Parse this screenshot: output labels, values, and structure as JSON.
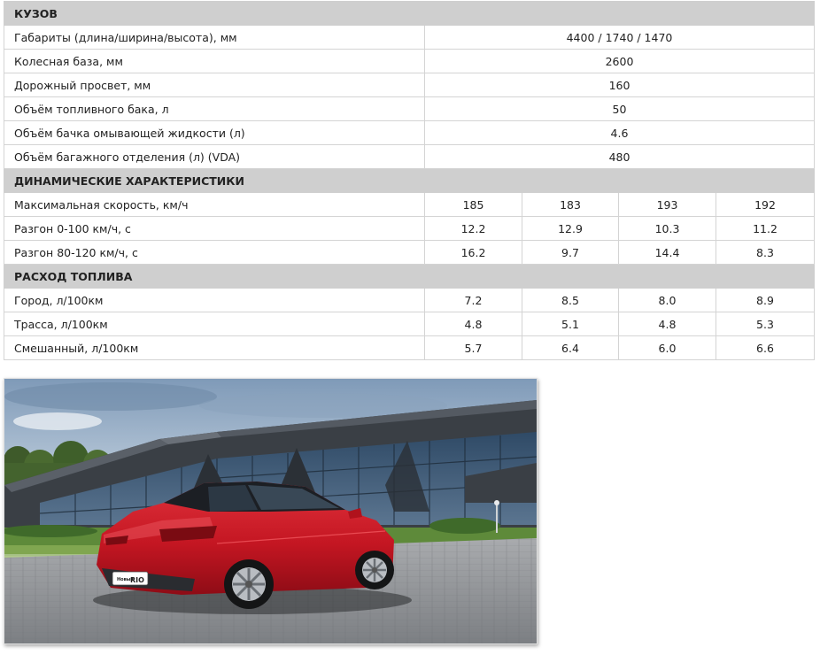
{
  "sections": [
    {
      "title": "КУЗОВ",
      "rows": [
        {
          "label": "Габариты (длина/ширина/высота), мм",
          "value": "4400 / 1740 / 1470",
          "highlighted": true
        },
        {
          "label": "Колесная база, мм",
          "value": "2600"
        },
        {
          "label": "Дорожный просвет, мм",
          "value": "160"
        },
        {
          "label": "Объём топливного бака, л",
          "value": "50"
        },
        {
          "label": "Объём бачка омывающей жидкости (л)",
          "value": "4.6"
        },
        {
          "label": "Объём багажного отделения (л) (VDA)",
          "value": "480"
        }
      ]
    },
    {
      "title": "ДИНАМИЧЕСКИЕ ХАРАКТЕРИСТИКИ",
      "rows": [
        {
          "label": "Максимальная скорость, км/ч",
          "values": [
            "185",
            "183",
            "193",
            "192"
          ]
        },
        {
          "label": "Разгон 0-100 км/ч, с",
          "values": [
            "12.2",
            "12.9",
            "10.3",
            "11.2"
          ]
        },
        {
          "label": "Разгон 80-120 км/ч, с",
          "values": [
            "16.2",
            "9.7",
            "14.4",
            "8.3"
          ]
        }
      ]
    },
    {
      "title": "РАСХОД ТОПЛИВА",
      "rows": [
        {
          "label": "Город, л/100км",
          "values": [
            "7.2",
            "8.5",
            "8.0",
            "8.9"
          ]
        },
        {
          "label": "Трасса, л/100км",
          "values": [
            "4.8",
            "5.1",
            "4.8",
            "5.3"
          ]
        },
        {
          "label": "Смешанный, л/100км",
          "values": [
            "5.7",
            "6.4",
            "6.0",
            "6.6"
          ]
        }
      ]
    }
  ],
  "photo": {
    "badge_small": "Новый",
    "badge_big": "RIO"
  },
  "colors": {
    "section_bg": "#cfcfcf",
    "underline": "#d21a1a",
    "car_body": "#c41622"
  }
}
